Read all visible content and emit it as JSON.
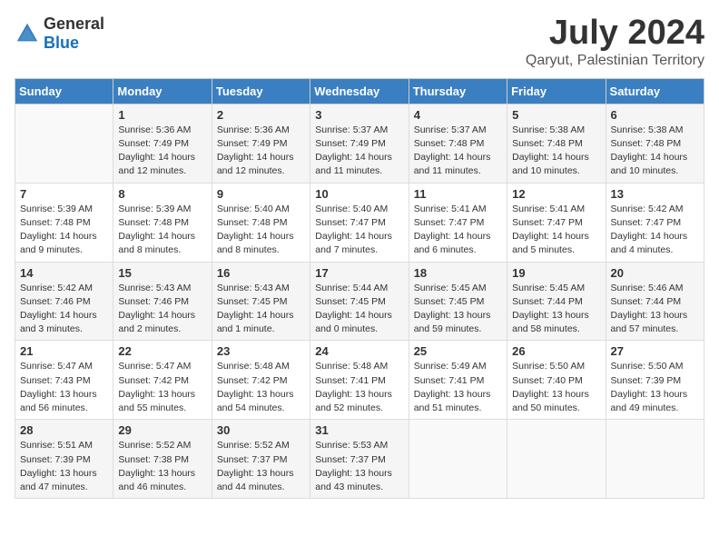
{
  "header": {
    "logo_general": "General",
    "logo_blue": "Blue",
    "main_title": "July 2024",
    "subtitle": "Qaryut, Palestinian Territory"
  },
  "columns": [
    "Sunday",
    "Monday",
    "Tuesday",
    "Wednesday",
    "Thursday",
    "Friday",
    "Saturday"
  ],
  "weeks": [
    {
      "days": [
        {
          "number": "",
          "info": ""
        },
        {
          "number": "1",
          "info": "Sunrise: 5:36 AM\nSunset: 7:49 PM\nDaylight: 14 hours\nand 12 minutes."
        },
        {
          "number": "2",
          "info": "Sunrise: 5:36 AM\nSunset: 7:49 PM\nDaylight: 14 hours\nand 12 minutes."
        },
        {
          "number": "3",
          "info": "Sunrise: 5:37 AM\nSunset: 7:49 PM\nDaylight: 14 hours\nand 11 minutes."
        },
        {
          "number": "4",
          "info": "Sunrise: 5:37 AM\nSunset: 7:48 PM\nDaylight: 14 hours\nand 11 minutes."
        },
        {
          "number": "5",
          "info": "Sunrise: 5:38 AM\nSunset: 7:48 PM\nDaylight: 14 hours\nand 10 minutes."
        },
        {
          "number": "6",
          "info": "Sunrise: 5:38 AM\nSunset: 7:48 PM\nDaylight: 14 hours\nand 10 minutes."
        }
      ]
    },
    {
      "days": [
        {
          "number": "7",
          "info": "Sunrise: 5:39 AM\nSunset: 7:48 PM\nDaylight: 14 hours\nand 9 minutes."
        },
        {
          "number": "8",
          "info": "Sunrise: 5:39 AM\nSunset: 7:48 PM\nDaylight: 14 hours\nand 8 minutes."
        },
        {
          "number": "9",
          "info": "Sunrise: 5:40 AM\nSunset: 7:48 PM\nDaylight: 14 hours\nand 8 minutes."
        },
        {
          "number": "10",
          "info": "Sunrise: 5:40 AM\nSunset: 7:47 PM\nDaylight: 14 hours\nand 7 minutes."
        },
        {
          "number": "11",
          "info": "Sunrise: 5:41 AM\nSunset: 7:47 PM\nDaylight: 14 hours\nand 6 minutes."
        },
        {
          "number": "12",
          "info": "Sunrise: 5:41 AM\nSunset: 7:47 PM\nDaylight: 14 hours\nand 5 minutes."
        },
        {
          "number": "13",
          "info": "Sunrise: 5:42 AM\nSunset: 7:47 PM\nDaylight: 14 hours\nand 4 minutes."
        }
      ]
    },
    {
      "days": [
        {
          "number": "14",
          "info": "Sunrise: 5:42 AM\nSunset: 7:46 PM\nDaylight: 14 hours\nand 3 minutes."
        },
        {
          "number": "15",
          "info": "Sunrise: 5:43 AM\nSunset: 7:46 PM\nDaylight: 14 hours\nand 2 minutes."
        },
        {
          "number": "16",
          "info": "Sunrise: 5:43 AM\nSunset: 7:45 PM\nDaylight: 14 hours\nand 1 minute."
        },
        {
          "number": "17",
          "info": "Sunrise: 5:44 AM\nSunset: 7:45 PM\nDaylight: 14 hours\nand 0 minutes."
        },
        {
          "number": "18",
          "info": "Sunrise: 5:45 AM\nSunset: 7:45 PM\nDaylight: 13 hours\nand 59 minutes."
        },
        {
          "number": "19",
          "info": "Sunrise: 5:45 AM\nSunset: 7:44 PM\nDaylight: 13 hours\nand 58 minutes."
        },
        {
          "number": "20",
          "info": "Sunrise: 5:46 AM\nSunset: 7:44 PM\nDaylight: 13 hours\nand 57 minutes."
        }
      ]
    },
    {
      "days": [
        {
          "number": "21",
          "info": "Sunrise: 5:47 AM\nSunset: 7:43 PM\nDaylight: 13 hours\nand 56 minutes."
        },
        {
          "number": "22",
          "info": "Sunrise: 5:47 AM\nSunset: 7:42 PM\nDaylight: 13 hours\nand 55 minutes."
        },
        {
          "number": "23",
          "info": "Sunrise: 5:48 AM\nSunset: 7:42 PM\nDaylight: 13 hours\nand 54 minutes."
        },
        {
          "number": "24",
          "info": "Sunrise: 5:48 AM\nSunset: 7:41 PM\nDaylight: 13 hours\nand 52 minutes."
        },
        {
          "number": "25",
          "info": "Sunrise: 5:49 AM\nSunset: 7:41 PM\nDaylight: 13 hours\nand 51 minutes."
        },
        {
          "number": "26",
          "info": "Sunrise: 5:50 AM\nSunset: 7:40 PM\nDaylight: 13 hours\nand 50 minutes."
        },
        {
          "number": "27",
          "info": "Sunrise: 5:50 AM\nSunset: 7:39 PM\nDaylight: 13 hours\nand 49 minutes."
        }
      ]
    },
    {
      "days": [
        {
          "number": "28",
          "info": "Sunrise: 5:51 AM\nSunset: 7:39 PM\nDaylight: 13 hours\nand 47 minutes."
        },
        {
          "number": "29",
          "info": "Sunrise: 5:52 AM\nSunset: 7:38 PM\nDaylight: 13 hours\nand 46 minutes."
        },
        {
          "number": "30",
          "info": "Sunrise: 5:52 AM\nSunset: 7:37 PM\nDaylight: 13 hours\nand 44 minutes."
        },
        {
          "number": "31",
          "info": "Sunrise: 5:53 AM\nSunset: 7:37 PM\nDaylight: 13 hours\nand 43 minutes."
        },
        {
          "number": "",
          "info": ""
        },
        {
          "number": "",
          "info": ""
        },
        {
          "number": "",
          "info": ""
        }
      ]
    }
  ]
}
